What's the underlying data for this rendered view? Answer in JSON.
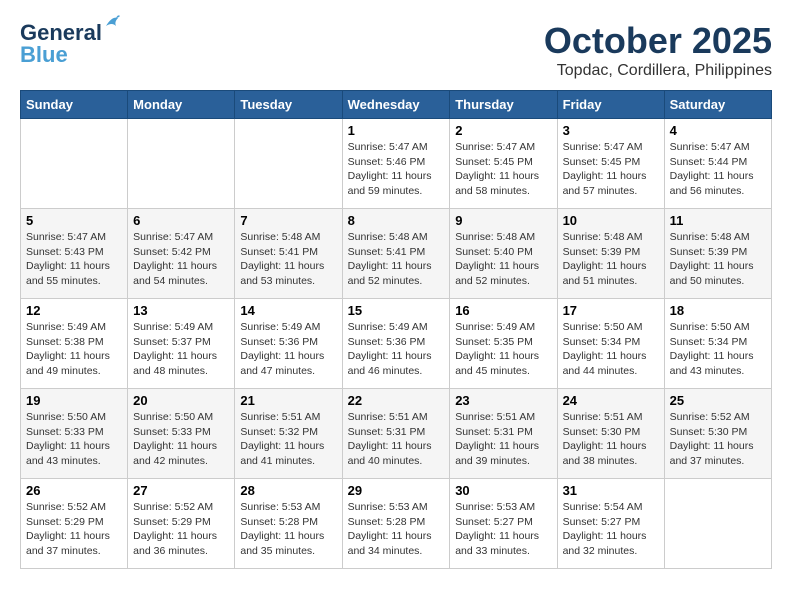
{
  "header": {
    "logo_line1": "General",
    "logo_line2": "Blue",
    "month": "October 2025",
    "location": "Topdac, Cordillera, Philippines"
  },
  "days_of_week": [
    "Sunday",
    "Monday",
    "Tuesday",
    "Wednesday",
    "Thursday",
    "Friday",
    "Saturday"
  ],
  "weeks": [
    [
      {
        "day": "",
        "info": ""
      },
      {
        "day": "",
        "info": ""
      },
      {
        "day": "",
        "info": ""
      },
      {
        "day": "1",
        "info": "Sunrise: 5:47 AM\nSunset: 5:46 PM\nDaylight: 11 hours\nand 59 minutes."
      },
      {
        "day": "2",
        "info": "Sunrise: 5:47 AM\nSunset: 5:45 PM\nDaylight: 11 hours\nand 58 minutes."
      },
      {
        "day": "3",
        "info": "Sunrise: 5:47 AM\nSunset: 5:45 PM\nDaylight: 11 hours\nand 57 minutes."
      },
      {
        "day": "4",
        "info": "Sunrise: 5:47 AM\nSunset: 5:44 PM\nDaylight: 11 hours\nand 56 minutes."
      }
    ],
    [
      {
        "day": "5",
        "info": "Sunrise: 5:47 AM\nSunset: 5:43 PM\nDaylight: 11 hours\nand 55 minutes."
      },
      {
        "day": "6",
        "info": "Sunrise: 5:47 AM\nSunset: 5:42 PM\nDaylight: 11 hours\nand 54 minutes."
      },
      {
        "day": "7",
        "info": "Sunrise: 5:48 AM\nSunset: 5:41 PM\nDaylight: 11 hours\nand 53 minutes."
      },
      {
        "day": "8",
        "info": "Sunrise: 5:48 AM\nSunset: 5:41 PM\nDaylight: 11 hours\nand 52 minutes."
      },
      {
        "day": "9",
        "info": "Sunrise: 5:48 AM\nSunset: 5:40 PM\nDaylight: 11 hours\nand 52 minutes."
      },
      {
        "day": "10",
        "info": "Sunrise: 5:48 AM\nSunset: 5:39 PM\nDaylight: 11 hours\nand 51 minutes."
      },
      {
        "day": "11",
        "info": "Sunrise: 5:48 AM\nSunset: 5:39 PM\nDaylight: 11 hours\nand 50 minutes."
      }
    ],
    [
      {
        "day": "12",
        "info": "Sunrise: 5:49 AM\nSunset: 5:38 PM\nDaylight: 11 hours\nand 49 minutes."
      },
      {
        "day": "13",
        "info": "Sunrise: 5:49 AM\nSunset: 5:37 PM\nDaylight: 11 hours\nand 48 minutes."
      },
      {
        "day": "14",
        "info": "Sunrise: 5:49 AM\nSunset: 5:36 PM\nDaylight: 11 hours\nand 47 minutes."
      },
      {
        "day": "15",
        "info": "Sunrise: 5:49 AM\nSunset: 5:36 PM\nDaylight: 11 hours\nand 46 minutes."
      },
      {
        "day": "16",
        "info": "Sunrise: 5:49 AM\nSunset: 5:35 PM\nDaylight: 11 hours\nand 45 minutes."
      },
      {
        "day": "17",
        "info": "Sunrise: 5:50 AM\nSunset: 5:34 PM\nDaylight: 11 hours\nand 44 minutes."
      },
      {
        "day": "18",
        "info": "Sunrise: 5:50 AM\nSunset: 5:34 PM\nDaylight: 11 hours\nand 43 minutes."
      }
    ],
    [
      {
        "day": "19",
        "info": "Sunrise: 5:50 AM\nSunset: 5:33 PM\nDaylight: 11 hours\nand 43 minutes."
      },
      {
        "day": "20",
        "info": "Sunrise: 5:50 AM\nSunset: 5:33 PM\nDaylight: 11 hours\nand 42 minutes."
      },
      {
        "day": "21",
        "info": "Sunrise: 5:51 AM\nSunset: 5:32 PM\nDaylight: 11 hours\nand 41 minutes."
      },
      {
        "day": "22",
        "info": "Sunrise: 5:51 AM\nSunset: 5:31 PM\nDaylight: 11 hours\nand 40 minutes."
      },
      {
        "day": "23",
        "info": "Sunrise: 5:51 AM\nSunset: 5:31 PM\nDaylight: 11 hours\nand 39 minutes."
      },
      {
        "day": "24",
        "info": "Sunrise: 5:51 AM\nSunset: 5:30 PM\nDaylight: 11 hours\nand 38 minutes."
      },
      {
        "day": "25",
        "info": "Sunrise: 5:52 AM\nSunset: 5:30 PM\nDaylight: 11 hours\nand 37 minutes."
      }
    ],
    [
      {
        "day": "26",
        "info": "Sunrise: 5:52 AM\nSunset: 5:29 PM\nDaylight: 11 hours\nand 37 minutes."
      },
      {
        "day": "27",
        "info": "Sunrise: 5:52 AM\nSunset: 5:29 PM\nDaylight: 11 hours\nand 36 minutes."
      },
      {
        "day": "28",
        "info": "Sunrise: 5:53 AM\nSunset: 5:28 PM\nDaylight: 11 hours\nand 35 minutes."
      },
      {
        "day": "29",
        "info": "Sunrise: 5:53 AM\nSunset: 5:28 PM\nDaylight: 11 hours\nand 34 minutes."
      },
      {
        "day": "30",
        "info": "Sunrise: 5:53 AM\nSunset: 5:27 PM\nDaylight: 11 hours\nand 33 minutes."
      },
      {
        "day": "31",
        "info": "Sunrise: 5:54 AM\nSunset: 5:27 PM\nDaylight: 11 hours\nand 32 minutes."
      },
      {
        "day": "",
        "info": ""
      }
    ]
  ]
}
